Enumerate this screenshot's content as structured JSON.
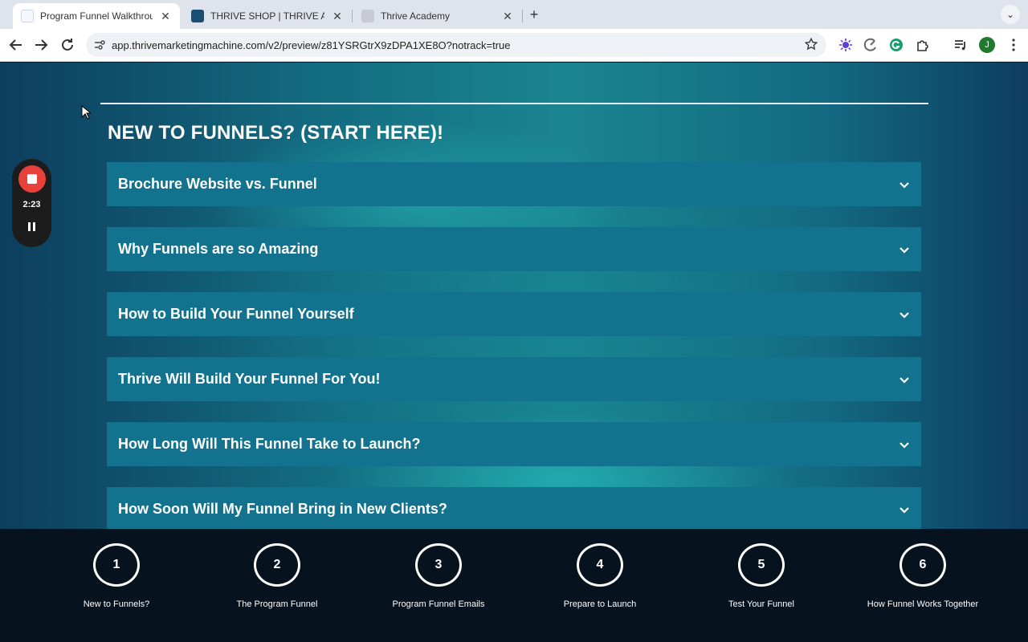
{
  "browser": {
    "tabs": [
      {
        "title": "Program Funnel Walkthrough",
        "close": "✕",
        "favicon_color": "#f4f7ff"
      },
      {
        "title": "THRIVE SHOP | THRIVE ACAD",
        "close": "✕",
        "favicon_color": "#1b4f72"
      },
      {
        "title": "Thrive Academy",
        "close": "✕",
        "favicon_color": "#c8ccd2"
      }
    ],
    "new_tab": "+",
    "tab_search": "⌄",
    "url": "app.thrivemarketingmachine.com/v2/preview/z81YSRGtrX9zDPA1XE8O?notrack=true",
    "profile_initial": "J"
  },
  "page": {
    "section_title": "NEW TO FUNNELS? (START HERE)!",
    "accordion": [
      "Brochure Website vs. Funnel",
      "Why Funnels are so Amazing",
      "How to Build Your Funnel Yourself",
      "Thrive Will Build Your Funnel For You!",
      "How Long Will This Funnel Take to Launch?",
      "How Soon Will My Funnel Bring in New Clients?"
    ],
    "steps": [
      {
        "number": "1",
        "label": "New to Funnels?"
      },
      {
        "number": "2",
        "label": "The Program Funnel"
      },
      {
        "number": "3",
        "label": "Program Funnel Emails"
      },
      {
        "number": "4",
        "label": "Prepare to Launch"
      },
      {
        "number": "5",
        "label": "Test Your Funnel"
      },
      {
        "number": "6",
        "label": "How Funnel Works Together"
      }
    ]
  },
  "recorder": {
    "time": "2:23"
  },
  "colors": {
    "accordion_bg": "#13738e",
    "nav_bg": "#06121e",
    "record_red": "#e8403b"
  }
}
